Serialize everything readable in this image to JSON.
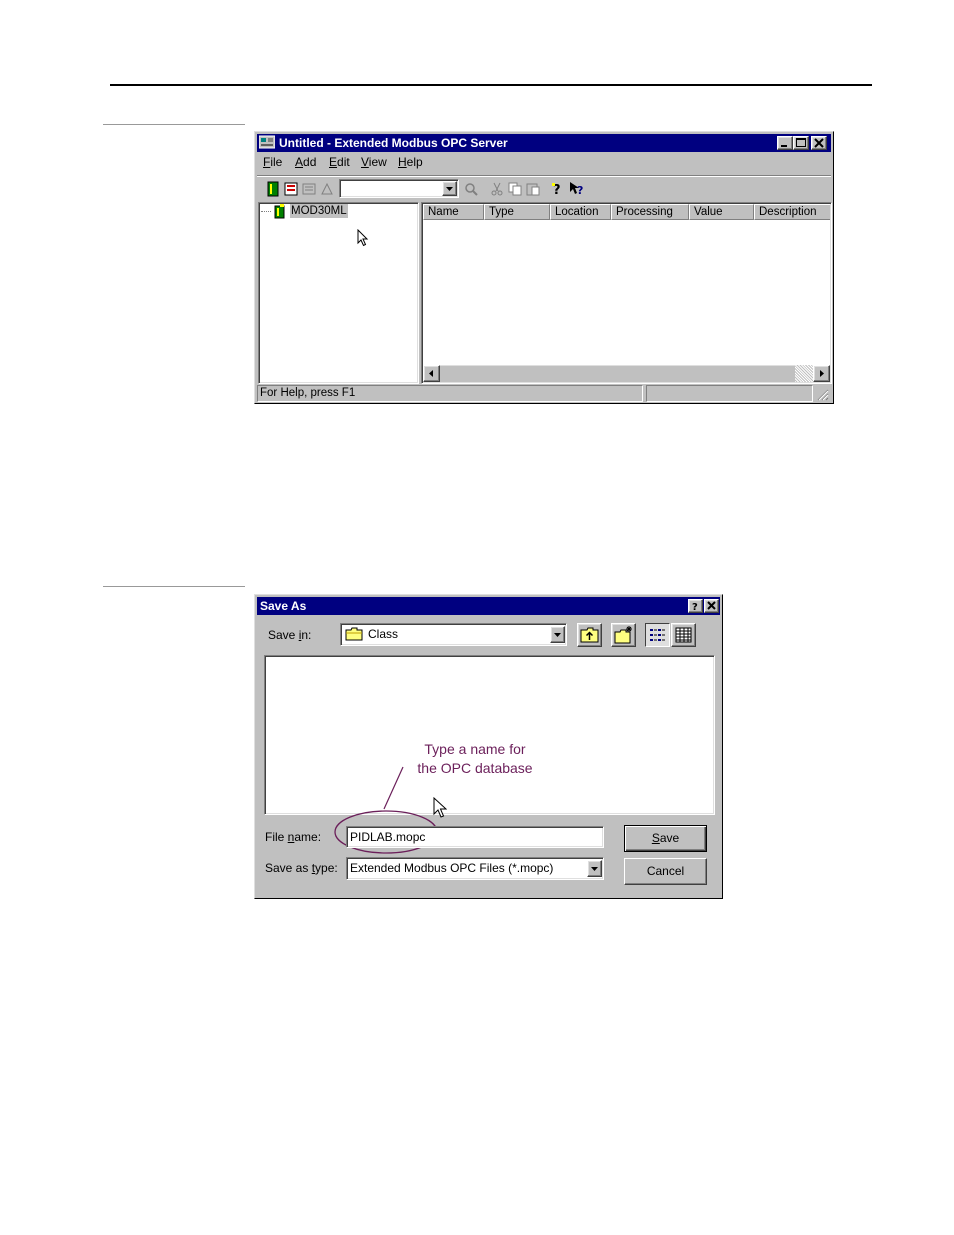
{
  "opc_window": {
    "title": "Untitled - Extended Modbus OPC Server",
    "menu": [
      {
        "pre": "",
        "ul": "F",
        "post": "ile"
      },
      {
        "pre": "",
        "ul": "A",
        "post": "dd"
      },
      {
        "pre": "",
        "ul": "E",
        "post": "dit"
      },
      {
        "pre": "",
        "ul": "V",
        "post": "iew"
      },
      {
        "pre": "",
        "ul": "H",
        "post": "elp"
      }
    ],
    "tree_item": "MOD30ML",
    "columns": [
      "Name",
      "Type",
      "Location",
      "Processing",
      "Value",
      "Description"
    ],
    "status_text": "For Help, press F1"
  },
  "save_dialog": {
    "title": "Save As",
    "save_in_label_pre": "Save ",
    "save_in_label_ul": "i",
    "save_in_label_post": "n:",
    "save_in_value": "Class",
    "file_name_label_pre": "File ",
    "file_name_label_ul": "n",
    "file_name_label_post": "ame:",
    "file_name_value": "PIDLAB.mopc",
    "save_as_type_label_pre": "Save as ",
    "save_as_type_label_ul": "t",
    "save_as_type_label_post": "ype:",
    "save_as_type_value": "Extended Modbus OPC Files (*.mopc)",
    "save_button_ul": "S",
    "save_button_post": "ave",
    "cancel_button": "Cancel",
    "annotation_line1": "Type a name for",
    "annotation_line2": "the OPC database"
  },
  "colors": {
    "titlebar": "#000080",
    "face": "#c0c0c0",
    "annotation": "#6b1f5a"
  }
}
